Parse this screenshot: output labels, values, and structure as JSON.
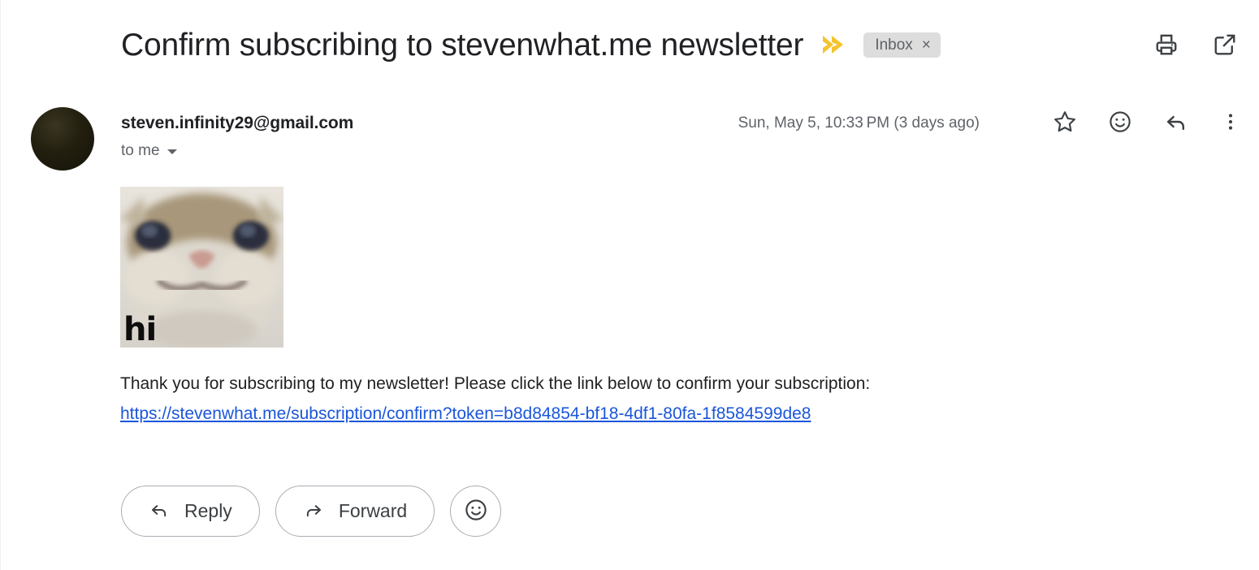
{
  "header": {
    "subject": "Confirm subscribing to stevenwhat.me newsletter",
    "importance_marker_icon": "yellow-chevron-importance-icon",
    "label_chip": {
      "text": "Inbox",
      "remove_icon": "×"
    },
    "actions": [
      {
        "name": "print-icon",
        "label": "Print"
      },
      {
        "name": "open-in-new-window-icon",
        "label": "Open in new window"
      }
    ]
  },
  "message": {
    "avatar_alt": "sender-avatar",
    "sender_email": "steven.infinity29@gmail.com",
    "recipient_line": "to me",
    "recipient_expand_icon": "caret-down-icon",
    "timestamp": "Sun, May 5, 10:33 PM (3 days ago)",
    "actions": [
      {
        "name": "star-icon",
        "label": "Star"
      },
      {
        "name": "add-reaction-icon",
        "label": "Add emoji reaction"
      },
      {
        "name": "reply-icon",
        "label": "Reply"
      },
      {
        "name": "more-options-icon",
        "label": "More"
      }
    ]
  },
  "body": {
    "image": {
      "name": "cat-meme-image",
      "caption_text": "hi",
      "alt": "Close-up photo of a cat face"
    },
    "paragraph": "Thank you for subscribing to my newsletter! Please click the link below to confirm your subscription:",
    "link_text": "https://stevenwhat.me/subscription/confirm?token=b8d84854-bf18-4df1-80fa-1f8584599de8"
  },
  "footer": {
    "reply_label": "Reply",
    "forward_label": "Forward",
    "reaction_icon": "smiley-face-icon"
  },
  "colors": {
    "link": "#1a56db",
    "importance_marker": "#f4c430",
    "chip_bg": "#ddddde",
    "text_primary": "#202124",
    "text_secondary": "#5f6368"
  }
}
